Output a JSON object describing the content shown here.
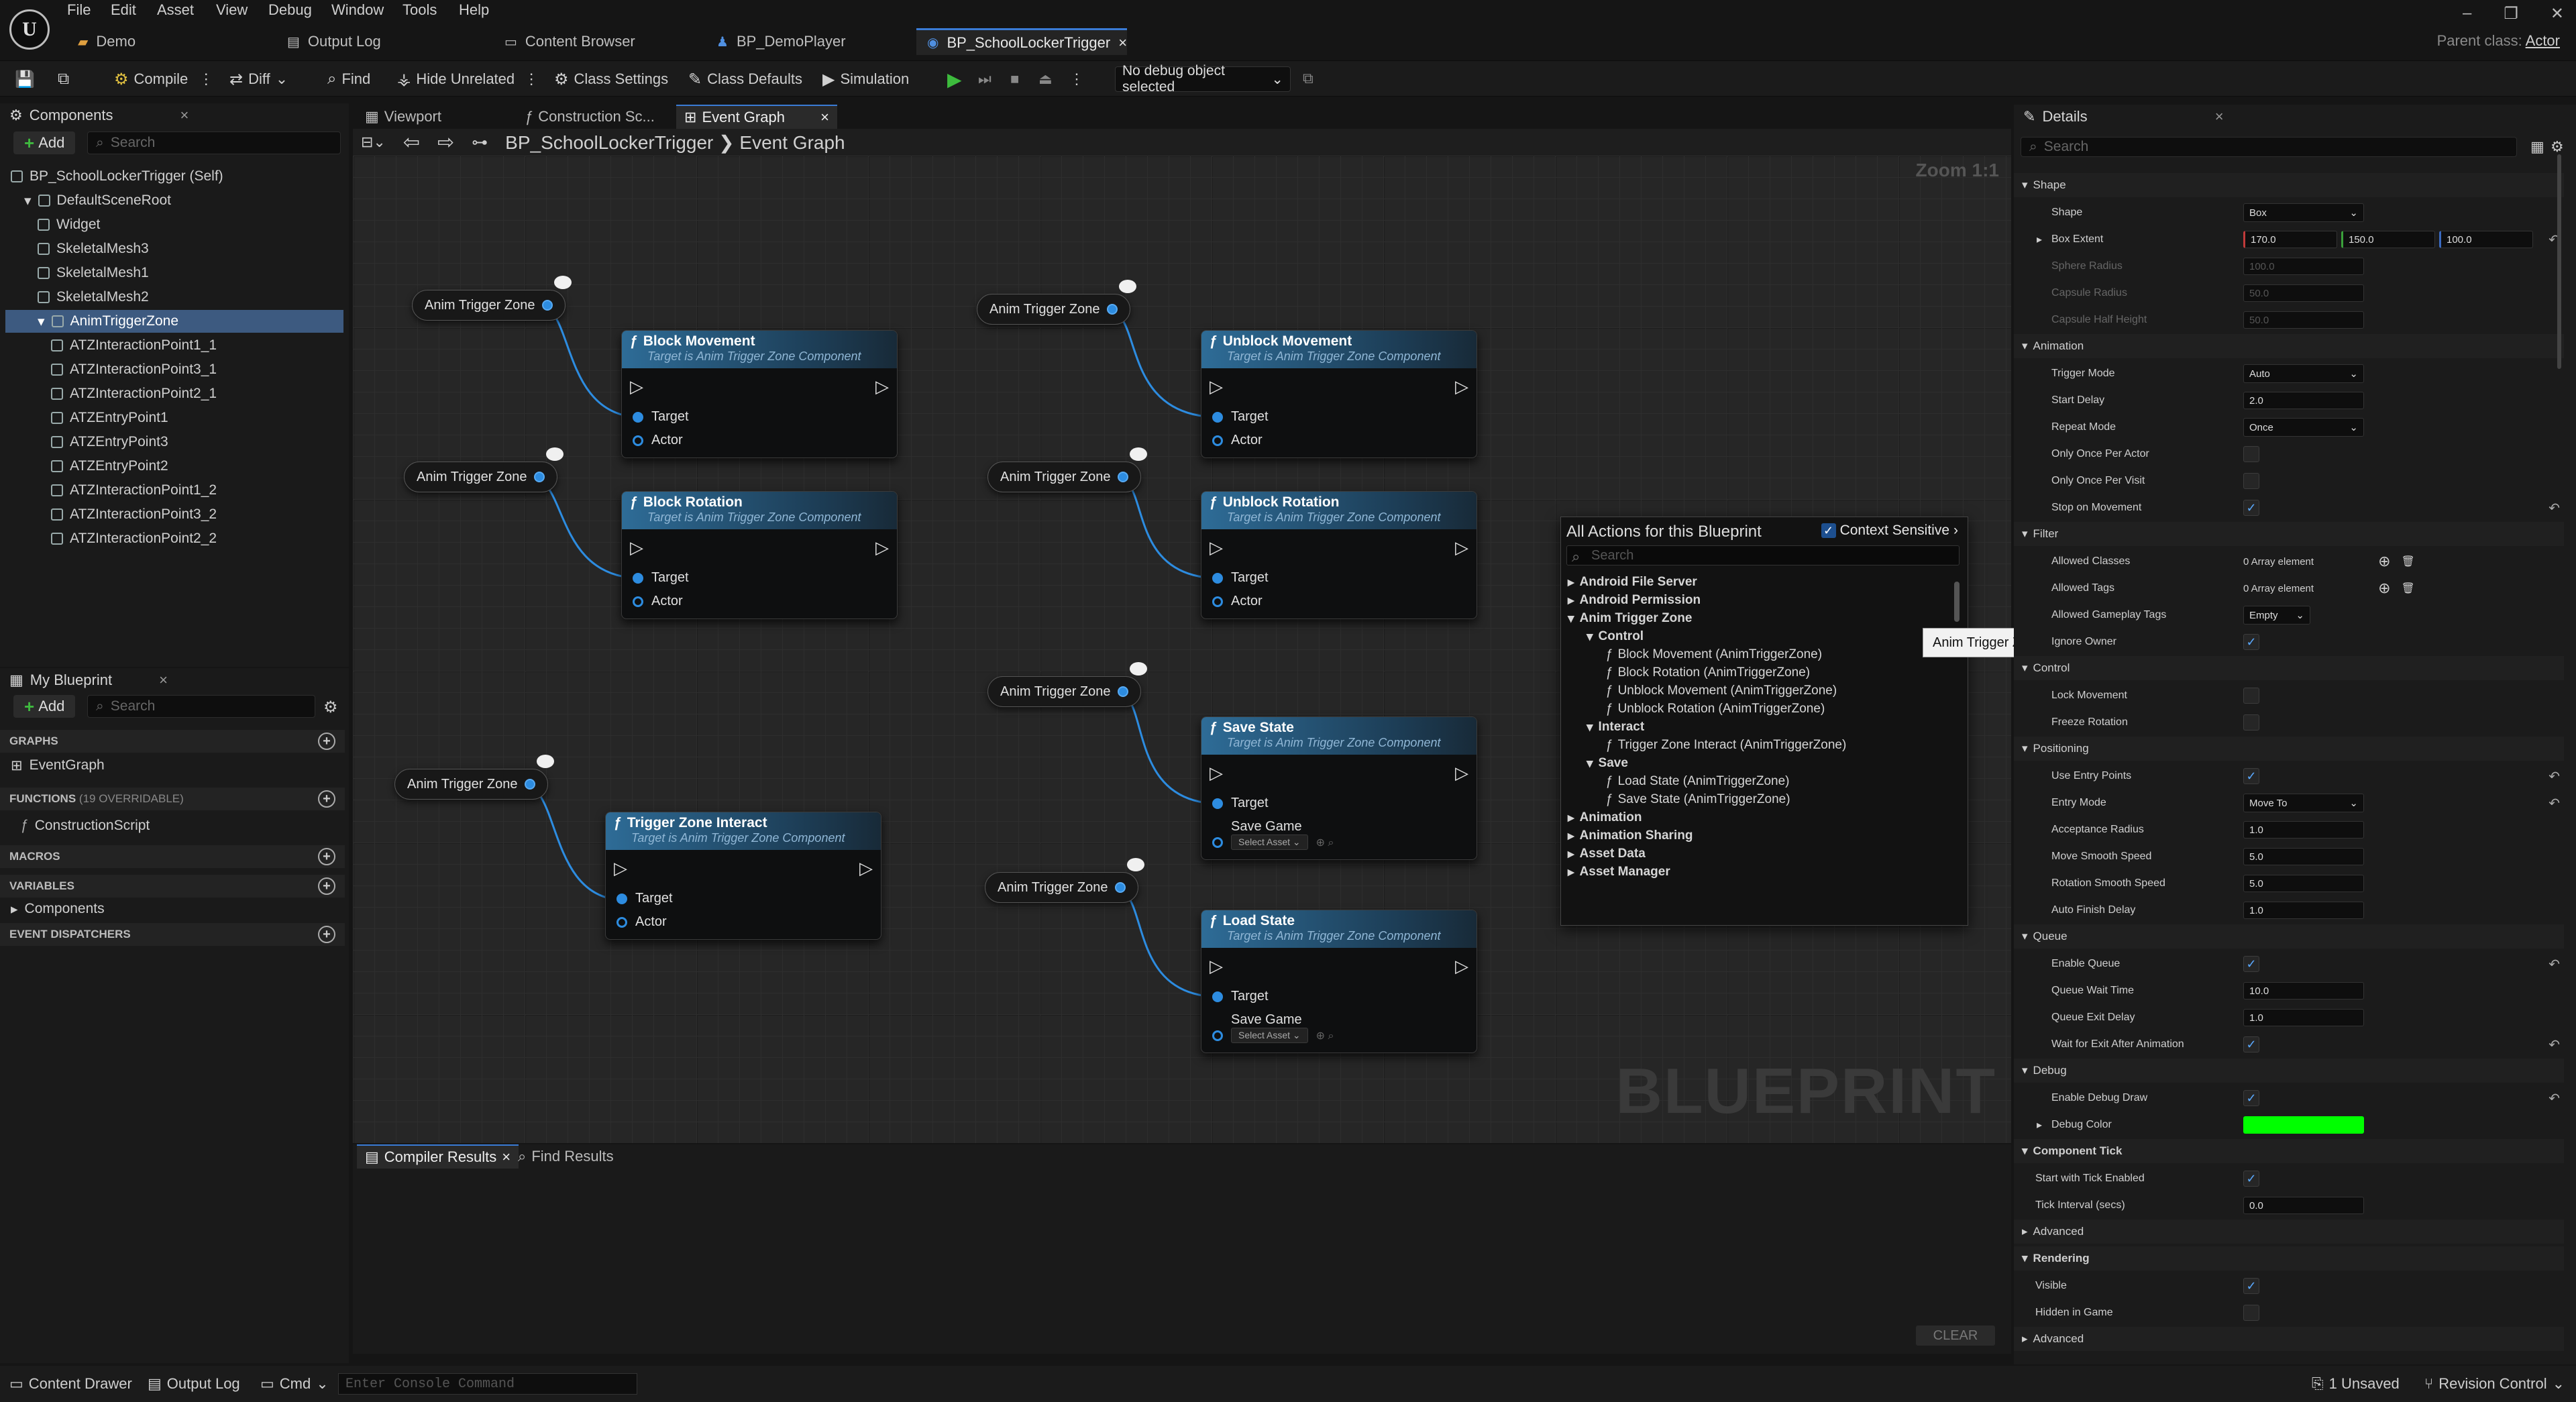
{
  "menu": {
    "items": [
      "File",
      "Edit",
      "Asset",
      "View",
      "Debug",
      "Window",
      "Tools",
      "Help"
    ]
  },
  "doc_tabs": [
    {
      "label": "Demo",
      "icon": "level-icon"
    },
    {
      "label": "Output Log",
      "icon": "log-icon"
    },
    {
      "label": "Content Browser",
      "icon": "folder-icon"
    },
    {
      "label": "BP_DemoPlayer",
      "icon": "pawn-icon"
    },
    {
      "label": "BP_SchoolLockerTrigger",
      "icon": "actor-icon",
      "active": true
    }
  ],
  "parent_class": {
    "label": "Parent class:",
    "value": "Actor"
  },
  "toolbar": {
    "compile": "Compile",
    "diff": "Diff",
    "find": "Find",
    "hide_unrelated": "Hide Unrelated",
    "class_settings": "Class Settings",
    "class_defaults": "Class Defaults",
    "simulation": "Simulation",
    "debug_object": "No debug object selected"
  },
  "components": {
    "title": "Components",
    "add": "Add",
    "search_placeholder": "Search",
    "tree": [
      {
        "label": "BP_SchoolLockerTrigger (Self)",
        "indent": 0
      },
      {
        "label": "DefaultSceneRoot",
        "indent": 1
      },
      {
        "label": "Widget",
        "indent": 2
      },
      {
        "label": "SkeletalMesh3",
        "indent": 2
      },
      {
        "label": "SkeletalMesh1",
        "indent": 2
      },
      {
        "label": "SkeletalMesh2",
        "indent": 2
      },
      {
        "label": "AnimTriggerZone",
        "indent": 2,
        "selected": true
      },
      {
        "label": "ATZInteractionPoint1_1",
        "indent": 3
      },
      {
        "label": "ATZInteractionPoint3_1",
        "indent": 3
      },
      {
        "label": "ATZInteractionPoint2_1",
        "indent": 3
      },
      {
        "label": "ATZEntryPoint1",
        "indent": 3
      },
      {
        "label": "ATZEntryPoint3",
        "indent": 3
      },
      {
        "label": "ATZEntryPoint2",
        "indent": 3
      },
      {
        "label": "ATZInteractionPoint1_2",
        "indent": 3
      },
      {
        "label": "ATZInteractionPoint3_2",
        "indent": 3
      },
      {
        "label": "ATZInteractionPoint2_2",
        "indent": 3
      }
    ]
  },
  "my_blueprint": {
    "title": "My Blueprint",
    "add": "Add",
    "search_placeholder": "Search",
    "graphs": "GRAPHS",
    "event_graph": "EventGraph",
    "functions": "FUNCTIONS",
    "functions_count": "(19 OVERRIDABLE)",
    "construction_script": "ConstructionScript",
    "macros": "MACROS",
    "variables": "VARIABLES",
    "components": "Components",
    "event_dispatchers": "EVENT DISPATCHERS"
  },
  "graph_tabs": [
    {
      "label": "Viewport"
    },
    {
      "label": "Construction Sc..."
    },
    {
      "label": "Event Graph",
      "active": true
    }
  ],
  "breadcrumb": {
    "blueprint": "BP_SchoolLockerTrigger",
    "graph": "Event Graph"
  },
  "zoom": "Zoom 1:1",
  "watermark": "BLUEPRINT",
  "nodes": {
    "anim_label": "Anim Trigger Zone",
    "subtitle": "Target is Anim Trigger Zone Component",
    "target": "Target",
    "actor": "Actor",
    "save_game": "Save Game",
    "select_asset": "Select Asset",
    "block_movement": "Block Movement",
    "block_rotation": "Block Rotation",
    "unblock_movement": "Unblock Movement",
    "unblock_rotation": "Unblock Rotation",
    "trigger_zone_interact": "Trigger Zone Interact",
    "save_state": "Save State",
    "load_state": "Load State"
  },
  "context_menu": {
    "title": "All Actions for this Blueprint",
    "context_sensitive": "Context Sensitive",
    "search_placeholder": "Search",
    "rows": [
      {
        "label": "Android File Server",
        "level": 0,
        "expander": "▸"
      },
      {
        "label": "Android Permission",
        "level": 0,
        "expander": "▸"
      },
      {
        "label": "Anim Trigger Zone",
        "level": 0,
        "expander": "▾"
      },
      {
        "label": "Control",
        "level": 1,
        "expander": "▾"
      },
      {
        "label": "Block Movement (AnimTriggerZone)",
        "level": 2,
        "fn": true
      },
      {
        "label": "Block Rotation (AnimTriggerZone)",
        "level": 2,
        "fn": true
      },
      {
        "label": "Unblock Movement (AnimTriggerZone)",
        "level": 2,
        "fn": true
      },
      {
        "label": "Unblock Rotation (AnimTriggerZone)",
        "level": 2,
        "fn": true
      },
      {
        "label": "Interact",
        "level": 1,
        "expander": "▾"
      },
      {
        "label": "Trigger Zone Interact (AnimTriggerZone)",
        "level": 2,
        "fn": true
      },
      {
        "label": "Save",
        "level": 1,
        "expander": "▾"
      },
      {
        "label": "Load State (AnimTriggerZone)",
        "level": 2,
        "fn": true
      },
      {
        "label": "Save State (AnimTriggerZone)",
        "level": 2,
        "fn": true
      },
      {
        "label": "Animation",
        "level": 0,
        "expander": "▸"
      },
      {
        "label": "Animation Sharing",
        "level": 0,
        "expander": "▸"
      },
      {
        "label": "Asset Data",
        "level": 0,
        "expander": "▸"
      },
      {
        "label": "Asset Manager",
        "level": 0,
        "expander": "▸"
      }
    ]
  },
  "tooltip": "Anim Trigger Zone",
  "bottom_tabs": {
    "compiler_results": "Compiler Results",
    "find_results": "Find Results",
    "clear": "CLEAR"
  },
  "details": {
    "title": "Details",
    "search_placeholder": "Search",
    "rows": [
      {
        "type": "section",
        "label": "Shape"
      },
      {
        "type": "combo",
        "label": "Shape",
        "value": "Box"
      },
      {
        "type": "vec",
        "label": "Box Extent",
        "values": [
          "170.0",
          "150.0",
          "100.0"
        ],
        "reset": true,
        "expand": true
      },
      {
        "type": "field",
        "label": "Sphere Radius",
        "value": "100.0",
        "dim": true
      },
      {
        "type": "field",
        "label": "Capsule Radius",
        "value": "50.0",
        "dim": true
      },
      {
        "type": "field",
        "label": "Capsule Half Height",
        "value": "50.0",
        "dim": true
      },
      {
        "type": "section",
        "label": "Animation"
      },
      {
        "type": "combo",
        "label": "Trigger Mode",
        "value": "Auto"
      },
      {
        "type": "field",
        "label": "Start Delay",
        "value": "2.0"
      },
      {
        "type": "combo",
        "label": "Repeat Mode",
        "value": "Once"
      },
      {
        "type": "check",
        "label": "Only Once Per Actor",
        "checked": false
      },
      {
        "type": "check",
        "label": "Only Once Per Visit",
        "checked": false
      },
      {
        "type": "check",
        "label": "Stop on Movement",
        "checked": true,
        "reset": true
      },
      {
        "type": "section",
        "label": "Filter"
      },
      {
        "type": "array",
        "label": "Allowed Classes",
        "value": "0 Array element"
      },
      {
        "type": "array",
        "label": "Allowed Tags",
        "value": "0 Array element"
      },
      {
        "type": "combo",
        "label": "Allowed Gameplay Tags",
        "value": "Empty",
        "small": true
      },
      {
        "type": "check",
        "label": "Ignore Owner",
        "checked": true
      },
      {
        "type": "section",
        "label": "Control"
      },
      {
        "type": "check",
        "label": "Lock Movement",
        "checked": false
      },
      {
        "type": "check",
        "label": "Freeze Rotation",
        "checked": false
      },
      {
        "type": "section",
        "label": "Positioning"
      },
      {
        "type": "check",
        "label": "Use Entry Points",
        "checked": true,
        "reset": true
      },
      {
        "type": "combo",
        "label": "Entry Mode",
        "value": "Move To",
        "reset": true
      },
      {
        "type": "field",
        "label": "Acceptance Radius",
        "value": "1.0"
      },
      {
        "type": "field",
        "label": "Move Smooth Speed",
        "value": "5.0"
      },
      {
        "type": "field",
        "label": "Rotation Smooth Speed",
        "value": "5.0"
      },
      {
        "type": "field",
        "label": "Auto Finish Delay",
        "value": "1.0"
      },
      {
        "type": "section",
        "label": "Queue"
      },
      {
        "type": "check",
        "label": "Enable Queue",
        "checked": true,
        "reset": true
      },
      {
        "type": "field",
        "label": "Queue Wait Time",
        "value": "10.0"
      },
      {
        "type": "field",
        "label": "Queue Exit Delay",
        "value": "1.0"
      },
      {
        "type": "check",
        "label": "Wait for Exit After Animation",
        "checked": true,
        "reset": true
      },
      {
        "type": "section",
        "label": "Debug"
      },
      {
        "type": "check",
        "label": "Enable Debug Draw",
        "checked": true,
        "reset": true
      },
      {
        "type": "color",
        "label": "Debug Color",
        "color": "#00ff00",
        "expand": true
      },
      {
        "type": "section",
        "label": "Component Tick",
        "bold": true
      },
      {
        "type": "check",
        "label": "Start with Tick Enabled",
        "checked": true,
        "indent0": true
      },
      {
        "type": "field",
        "label": "Tick Interval (secs)",
        "value": "0.0",
        "indent0": true
      },
      {
        "type": "collapsed",
        "label": "Advanced"
      },
      {
        "type": "section",
        "label": "Rendering",
        "bold": true
      },
      {
        "type": "check",
        "label": "Visible",
        "checked": true,
        "indent0": true
      },
      {
        "type": "check",
        "label": "Hidden in Game",
        "checked": false,
        "indent0": true
      },
      {
        "type": "collapsed",
        "label": "Advanced"
      }
    ]
  },
  "statusbar": {
    "content_drawer": "Content Drawer",
    "output_log": "Output Log",
    "cmd": "Cmd",
    "console_placeholder": "Enter Console Command",
    "unsaved": "1 Unsaved",
    "revision_control": "Revision Control"
  },
  "colors": {
    "pin_blue": "#2d8ce0",
    "accent": "#3a7bd5",
    "debug_color": "#00ff00"
  }
}
